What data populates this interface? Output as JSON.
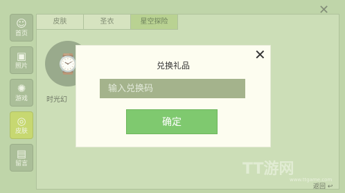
{
  "sidebar": {
    "items": [
      {
        "label": "首页",
        "icon": "user-circle-icon",
        "glyph": "☺",
        "active": false
      },
      {
        "label": "照片",
        "icon": "image-icon",
        "glyph": "▣",
        "active": false
      },
      {
        "label": "游戏",
        "icon": "atom-icon",
        "glyph": "✺",
        "active": false
      },
      {
        "label": "皮肤",
        "icon": "skin-icon",
        "glyph": "◎",
        "active": true
      },
      {
        "label": "留言",
        "icon": "message-icon",
        "glyph": "▤",
        "active": false
      }
    ]
  },
  "tabs": [
    "皮肤",
    "圣衣",
    "星空探险"
  ],
  "active_tab": "星空探险",
  "item": {
    "name": "时光幻",
    "glyph": "⌚"
  },
  "close_glyph": "✕",
  "footer": {
    "back_label": "返回"
  },
  "watermark": {
    "text": "TT游网",
    "url": "www.ttgame.com"
  },
  "modal": {
    "title": "兑换礼品",
    "close_glyph": "✕",
    "input_placeholder": "输入兑换码",
    "input_value": "",
    "confirm_label": "确定"
  },
  "colors": {
    "accent_green": "#7fc96f",
    "active_tab": "#9cc06a",
    "active_sidebar": "#b2c93a"
  }
}
